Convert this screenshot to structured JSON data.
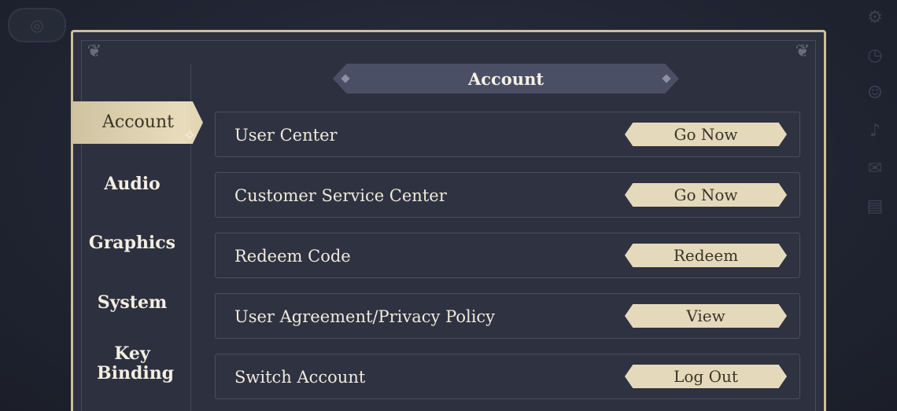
{
  "panel": {
    "title": "Account"
  },
  "sidebar": {
    "items": [
      {
        "label": "Account"
      },
      {
        "label": "Audio"
      },
      {
        "label": "Graphics"
      },
      {
        "label": "System"
      },
      {
        "label": "Key Binding"
      }
    ]
  },
  "rows": [
    {
      "label": "User Center",
      "button": "Go Now"
    },
    {
      "label": "Customer Service Center",
      "button": "Go Now"
    },
    {
      "label": "Redeem Code",
      "button": "Redeem"
    },
    {
      "label": "User Agreement/Privacy Policy",
      "button": "View"
    },
    {
      "label": "Switch Account",
      "button": "Log Out"
    }
  ],
  "colors": {
    "frame_gold": "#cdbf9a",
    "button_fill": "#e4d9ba",
    "panel_bg": "#2d303e"
  }
}
